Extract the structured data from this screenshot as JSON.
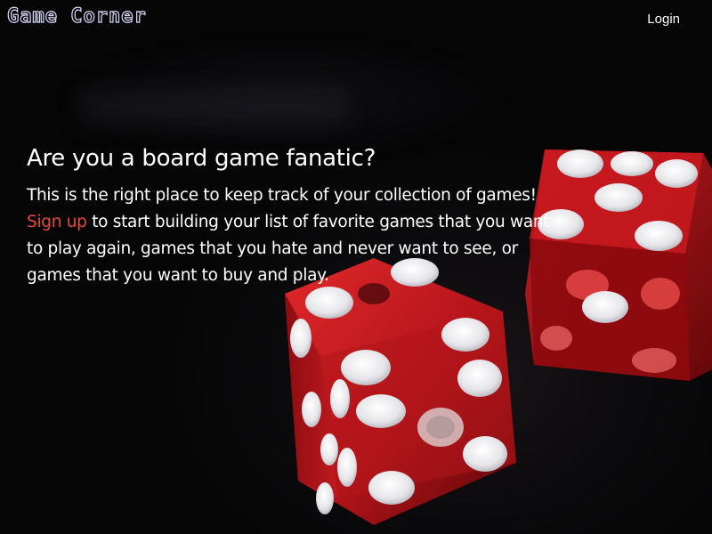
{
  "header": {
    "logo_text": "Game Corner",
    "login_label": "Login"
  },
  "hero": {
    "heading": "Are you a board game fanatic?",
    "paragraph_start": "This is the right place to keep track of your collection of games! ",
    "signup_link": "Sign up",
    "paragraph_end": " to start building your list of favorite games that you want to play again, games that you hate and never want to see, or games that you want to buy and play."
  },
  "background": {
    "image_subject": "red-dice-photo",
    "dice_color": "#c4161c",
    "pip_color": "#e9e9ee",
    "link_color": "#e8453c"
  }
}
